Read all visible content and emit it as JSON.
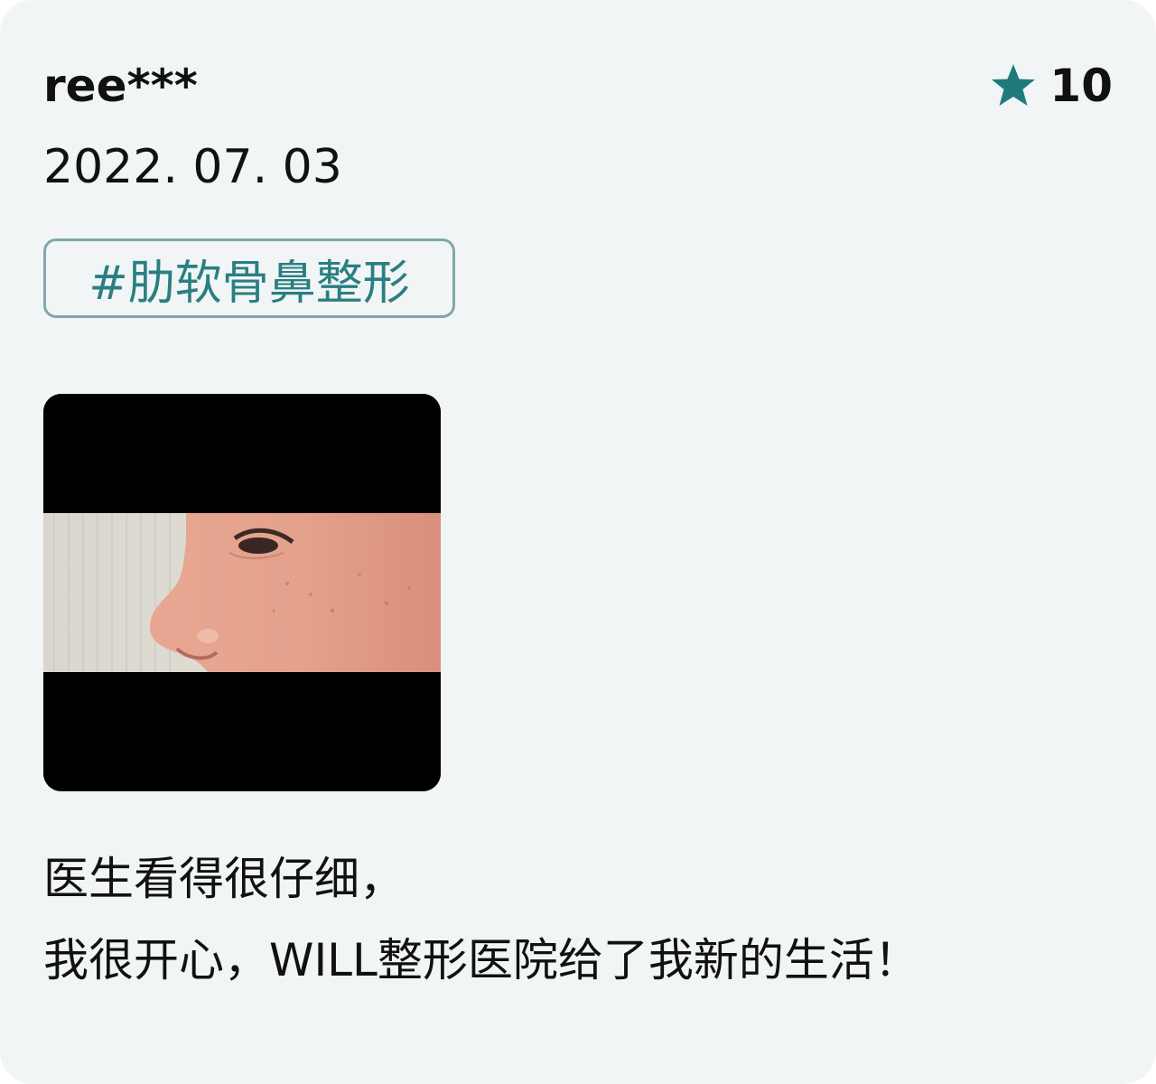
{
  "review": {
    "username": "ree***",
    "date": "2022. 07. 03",
    "rating": {
      "icon": "star-icon",
      "value": "10",
      "color": "#1f7a7c"
    },
    "tag": "#肋软骨鼻整形",
    "photo": {
      "description_icon": "nose-profile-photo"
    },
    "body_lines": [
      "医生看得很仔细，",
      "我很开心，WILL整形医院给了我新的生活！"
    ]
  },
  "colors": {
    "card_background": "#f1f5f6",
    "accent": "#2a7f82",
    "tag_border": "#7fa7ab",
    "text": "#111111"
  }
}
